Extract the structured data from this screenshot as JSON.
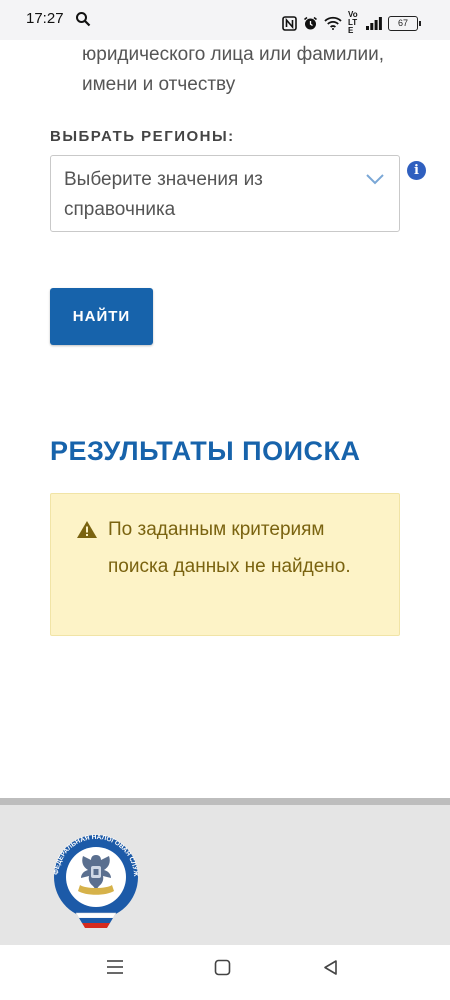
{
  "status_bar": {
    "time": "17:27",
    "battery": "67",
    "network_label": "Vo LTE"
  },
  "intro": {
    "text": "юридического лица или фамилии, имени и отчеству"
  },
  "region": {
    "label": "ВЫБРАТЬ РЕГИОНЫ:",
    "placeholder": "Выберите значения из справочника"
  },
  "actions": {
    "find_label": "НАЙТИ"
  },
  "results": {
    "title": "РЕЗУЛЬТАТЫ ПОИСКА",
    "message": "По заданным критериям поиска данных не найдено."
  },
  "footer": {
    "logo_text": "ФЕДЕРАЛЬНАЯ НАЛОГОВАЯ СЛУЖБА"
  },
  "colors": {
    "accent": "#1763ab",
    "warning_bg": "#fdf3c7",
    "warning_text": "#7a6310"
  }
}
